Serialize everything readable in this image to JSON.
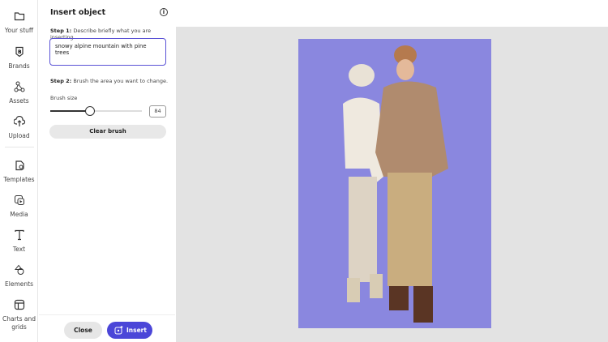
{
  "rail": [
    {
      "icon": "folder-icon",
      "label": "Your stuff"
    },
    {
      "icon": "brands-icon",
      "label": "Brands"
    },
    {
      "icon": "assets-icon",
      "label": "Assets"
    },
    {
      "icon": "upload-icon",
      "label": "Upload"
    },
    {
      "icon": "templates-icon",
      "label": "Templates"
    },
    {
      "icon": "media-icon",
      "label": "Media"
    },
    {
      "icon": "text-icon",
      "label": "Text"
    },
    {
      "icon": "elements-icon",
      "label": "Elements"
    },
    {
      "icon": "charts-grids-icon",
      "label": "Charts and grids"
    }
  ],
  "panel": {
    "title": "Insert object",
    "step1_label": "Step 1:",
    "step1_text": " Describe briefly what you are inserting.",
    "prompt_value": "snowy alpine mountain with pine trees",
    "step2_label": "Step 2:",
    "step2_text": " Brush the area you want to change.",
    "brush_label": "Brush size",
    "brush_value": "84",
    "brush_fraction": 0.43,
    "clear_label": "Clear brush",
    "close_label": "Close",
    "insert_label": "Insert"
  },
  "colors": {
    "accent": "#4b46d8",
    "photo_bg": "#8a87df",
    "canvas": "#e3e3e3"
  }
}
